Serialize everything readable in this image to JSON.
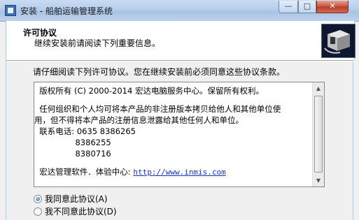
{
  "window": {
    "title": "安装 - 船舶运输管理系统",
    "controls": {
      "minimize": "—",
      "maximize": "□",
      "close": "✕"
    }
  },
  "header": {
    "title": "许可协议",
    "subtitle": "继续安装前请阅读下列重要信息。",
    "logo_icon": "installer-computer-icon"
  },
  "body": {
    "instruction": "请仔细阅读下列许可协议。您在继续安装前必须同意这些协议条款。",
    "license_lines": [
      "  版权所有 (C) 2000-2014 宏达电脑服务中心。保留所有权利。",
      "",
      "  任何组织和个人均可将本产品的非注册版本拷贝给他人和其他单位使",
      "用，但不得将本产品的注册信息泄露给其他任何人和单位。",
      "  联系电话: 0635 8386265",
      "                8386255",
      "                8380716",
      "",
      "  宏达管理软件．体验中心:"
    ],
    "url": "http://www.inmis.com",
    "radios": [
      {
        "label": "我同意此协议(A)",
        "checked": true
      },
      {
        "label": "我不同意此协议(D)",
        "checked": false
      }
    ]
  }
}
